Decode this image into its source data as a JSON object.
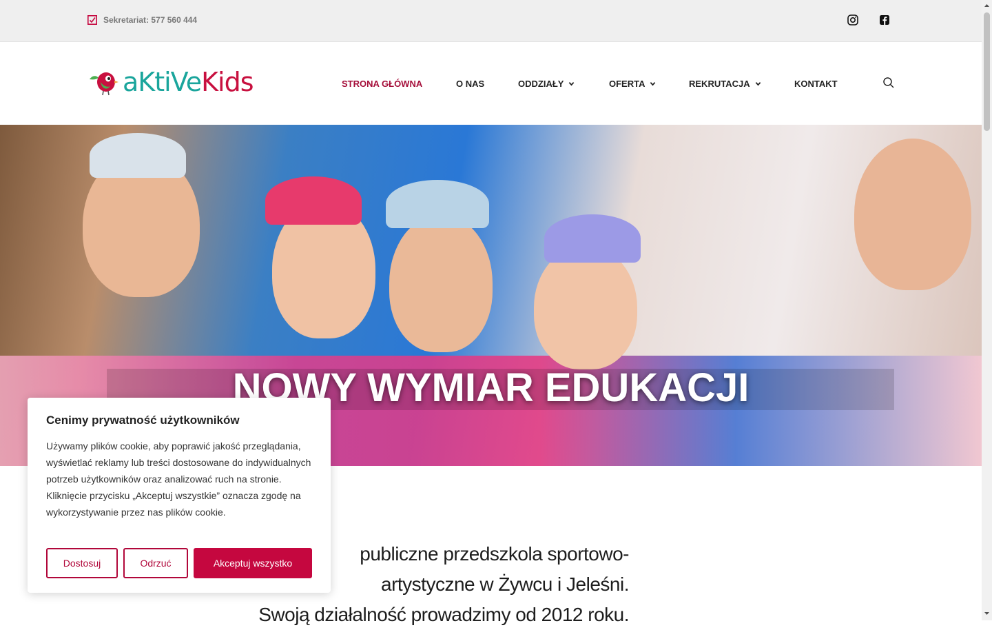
{
  "topbar": {
    "phone_text": "Sekretariat: 577 560 444",
    "icons": [
      "edit-square-icon",
      "instagram-icon",
      "facebook-icon"
    ]
  },
  "logo": {
    "text_teal": "aKtiVe",
    "text_pink": "Kids"
  },
  "nav": {
    "items": [
      {
        "label": "STRONA GŁÓWNA",
        "active": true,
        "dropdown": false
      },
      {
        "label": "O NAS",
        "active": false,
        "dropdown": false
      },
      {
        "label": "ODDZIAŁY",
        "active": false,
        "dropdown": true
      },
      {
        "label": "OFERTA",
        "active": false,
        "dropdown": true
      },
      {
        "label": "REKRUTACJA",
        "active": false,
        "dropdown": true
      },
      {
        "label": "KONTAKT",
        "active": false,
        "dropdown": false
      }
    ]
  },
  "hero": {
    "title": "NOWY WYMIAR EDUKACJI"
  },
  "intro": {
    "lines": [
      "publiczne przedszkola sportowo-",
      "artystyczne w Żywcu i Jeleśni.",
      "Swoją działalność prowadzimy od 2012 roku."
    ]
  },
  "cookie": {
    "title": "Cenimy prywatność użytkowników",
    "text": "Używamy plików cookie, aby poprawić jakość przeglądania, wyświetlać reklamy lub treści dostosowane do indywidualnych potrzeb użytkowników oraz analizować ruch na stronie. Kliknięcie przycisku „Akceptuj wszystkie” oznacza zgodę na wykorzystywanie przez nas plików cookie.",
    "btn_customize": "Dostosuj",
    "btn_reject": "Odrzuć",
    "btn_accept": "Akceptuj wszystko"
  },
  "colors": {
    "accent": "#c5073f",
    "logo_teal": "#1aa59c",
    "topbar_bg": "#efefef"
  }
}
